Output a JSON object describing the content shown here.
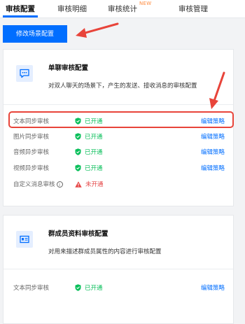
{
  "tabs": [
    {
      "label": "审核配置",
      "active": true
    },
    {
      "label": "审核明细"
    },
    {
      "label": "审核统计",
      "badge": "NEW"
    },
    {
      "label": "审核管理"
    }
  ],
  "edit_button": "修改场景配置",
  "single_chat": {
    "title": "单聊审核配置",
    "description": "对双人聊天的场景下，产生的发送、接收消息的审核配置",
    "rows": [
      {
        "label": "文本同步审核",
        "status": "已开通",
        "action": "编辑策略"
      },
      {
        "label": "图片同步审核",
        "status": "已开通",
        "action": "编辑策略"
      },
      {
        "label": "音频异步审核",
        "status": "已开通",
        "action": "编辑策略"
      },
      {
        "label": "视频异步审核",
        "status": "已开通",
        "action": "编辑策略"
      },
      {
        "label": "自定义消息审核",
        "status": "未开通"
      }
    ]
  },
  "group_member": {
    "title": "群成员资料审核配置",
    "description": "对用来描述群成员属性的内容进行审核配置",
    "rows": [
      {
        "label": "文本同步审核",
        "status": "已开通",
        "action": "编辑策略"
      }
    ]
  },
  "colors": {
    "accent": "#006eff",
    "enabled": "#0abf5b",
    "disabled": "#e54545",
    "annotation": "#e8443a",
    "badge": "#ff8a3d"
  },
  "icons": {
    "single_chat": "chat-bubble-icon",
    "group_member": "id-card-icon",
    "enabled": "shield-check-icon",
    "disabled": "warning-triangle-icon",
    "help": "help-circle-icon"
  }
}
